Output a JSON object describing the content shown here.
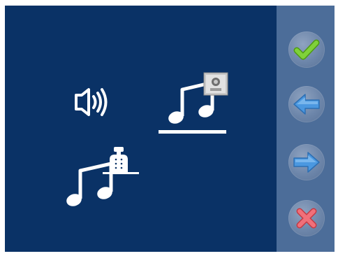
{
  "screen": {
    "options": [
      {
        "id": "speaker-volume",
        "icon": "speaker-volume-icon",
        "selected": false
      },
      {
        "id": "door-camera-melody",
        "icon": "melody-door-camera-icon",
        "selected": true
      },
      {
        "id": "intercom-melody",
        "icon": "melody-intercom-icon",
        "selected": false
      }
    ],
    "sidebar": {
      "buttons": [
        {
          "id": "confirm",
          "icon": "check-icon"
        },
        {
          "id": "previous",
          "icon": "arrow-left-icon"
        },
        {
          "id": "next",
          "icon": "arrow-right-icon"
        },
        {
          "id": "cancel",
          "icon": "close-icon"
        }
      ]
    }
  },
  "colors": {
    "background": "#0a3266",
    "sidebar": "#4c6d99",
    "check": "#6cc321",
    "arrow": "#3f8fd9",
    "close": "#e0505a",
    "icon": "#ffffff"
  }
}
